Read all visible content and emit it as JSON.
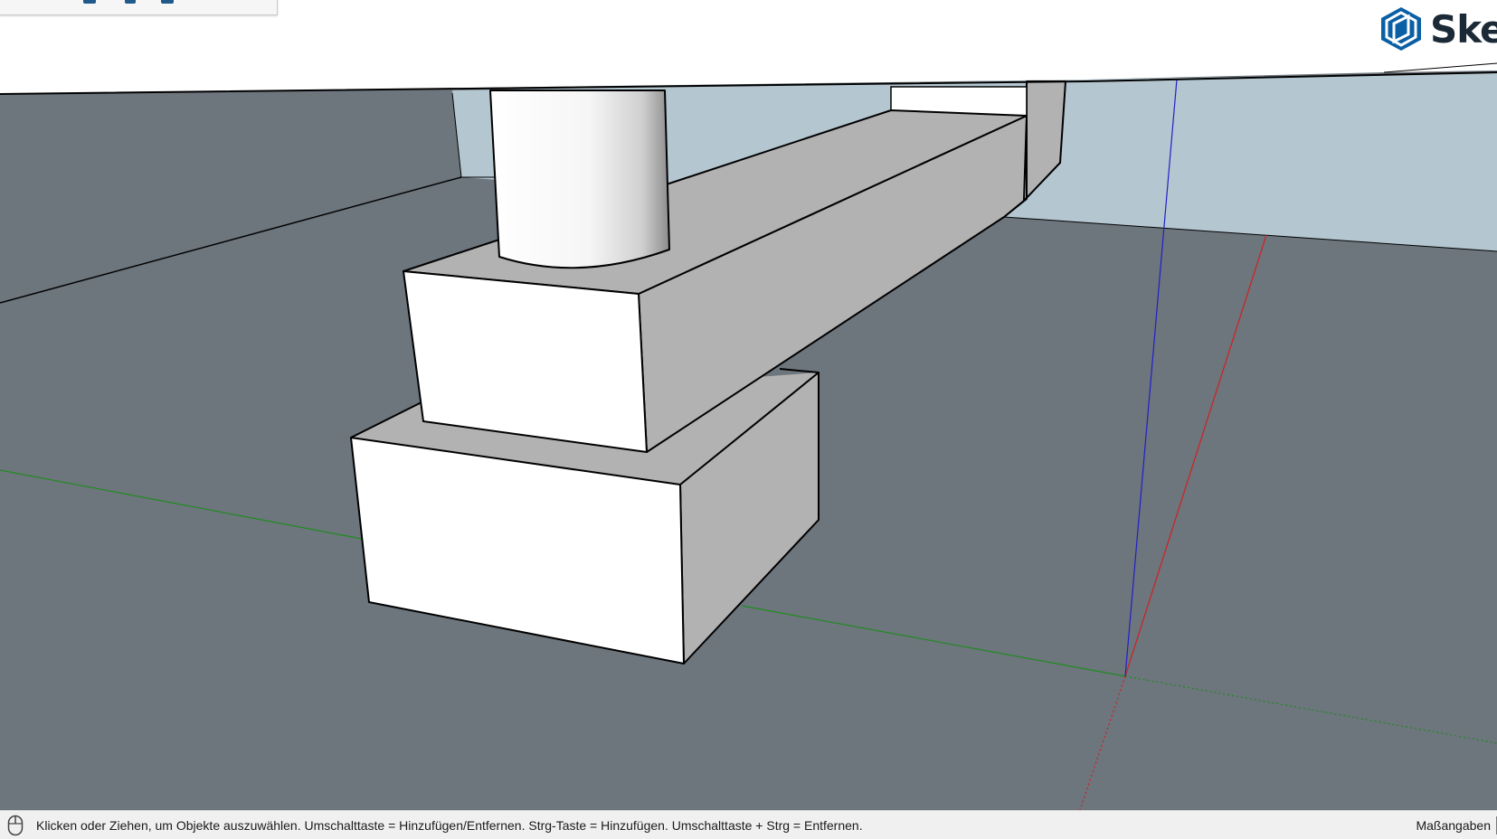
{
  "brand": {
    "text": "SketchUp",
    "icon": "sketchup-logo-icon"
  },
  "statusbar": {
    "message": "Klicken oder Ziehen, um Objekte auszuwählen. Umschalttaste = Hinzufügen/Entfernen. Strg-Taste = Hinzufügen. Umschalttaste + Strg = Entfernen.",
    "measurements_label": "Maßangaben",
    "icon": "mouse-icon"
  },
  "colors": {
    "ground": "#6d757d",
    "sky": "#b4c6d0",
    "face_light": "#ffffff",
    "face_shade": "#b2b2b2",
    "axis_red": "#d22020",
    "axis_green": "#1e8c1e",
    "axis_blue": "#2020c8",
    "edge": "#000000"
  }
}
